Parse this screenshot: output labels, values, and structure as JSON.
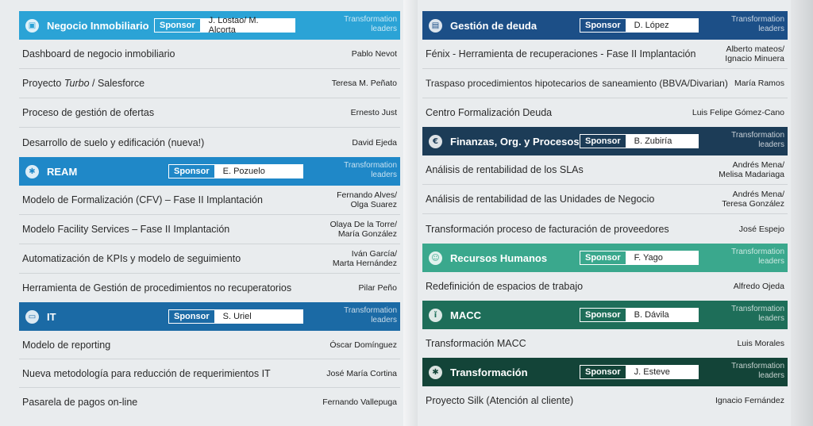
{
  "sponsor_label": "Sponsor",
  "tl_line1": "Transformation",
  "tl_line2": "leaders",
  "sections": {
    "negocio": {
      "title": "Negocio Inmobiliario",
      "sponsor": "J. Lostao/ M. Alcorta",
      "icon": "building-icon",
      "color": "#2ba3d6",
      "rows": [
        {
          "title": "Dashboard de negocio inmobiliario",
          "leader": "Pablo Nevot"
        },
        {
          "title_pre": "Proyecto ",
          "title_em": "Turbo",
          "title_post": " / Salesforce",
          "leader": "Teresa M. Peñato"
        },
        {
          "title": "Proceso de gestión de ofertas",
          "leader": "Ernesto Just"
        },
        {
          "title": "Desarrollo de suelo y edificación (nueva!)",
          "leader": "David Ejeda"
        }
      ]
    },
    "ream": {
      "title": "REAM",
      "sponsor": "E. Pozuelo",
      "icon": "gear-icon",
      "color": "#1f88c8",
      "rows": [
        {
          "title": "Modelo de Formalización (CFV) – Fase II Implantación",
          "leader1": "Fernando Alves/",
          "leader2": "Olga Suarez"
        },
        {
          "title": "Modelo Facility Services – Fase II Implantación",
          "leader1": "Olaya De la Torre/",
          "leader2": "María González"
        },
        {
          "title": "Automatización de KPIs y modelo de seguimiento",
          "leader1": "Iván García/",
          "leader2": "Marta Hernández"
        },
        {
          "title": "Herramienta de Gestión de procedimientos no recuperatorios",
          "leader": "Pilar Peño"
        }
      ]
    },
    "it": {
      "title": "IT",
      "sponsor": "S. Uriel",
      "icon": "monitor-icon",
      "color": "#1b6aa5",
      "rows": [
        {
          "title": "Modelo de reporting",
          "leader": "Óscar Domínguez"
        },
        {
          "title": "Nueva metodología para reducción de requerimientos IT",
          "leader": "José María Cortina"
        },
        {
          "title": "Pasarela de pagos on-line",
          "leader": "Fernando Vallepuga"
        }
      ]
    },
    "deuda": {
      "title": "Gestión de deuda",
      "sponsor": "D. López",
      "icon": "wallet-icon",
      "color": "#1c4f87",
      "rows": [
        {
          "title": "Fénix - Herramienta de recuperaciones - Fase II Implantación",
          "leader1": "Alberto mateos/",
          "leader2": "Ignacio Minuera"
        },
        {
          "title": "Traspaso procedimientos hipotecarios de saneamiento (BBVA/Divarian)",
          "leader": "María Ramos"
        },
        {
          "title": "Centro Formalización Deuda",
          "leader": "Luis Felipe Gómez-Cano"
        }
      ]
    },
    "finanzas": {
      "title": "Finanzas, Org. y Procesos",
      "sponsor": "B. Zubiría",
      "icon": "finance-icon",
      "color": "#1c3c57",
      "rows": [
        {
          "title": "Análisis de rentabilidad de los SLAs",
          "leader1": "Andrés Mena/",
          "leader2": "Melisa Madariaga"
        },
        {
          "title": "Análisis de rentabilidad de las Unidades de Negocio",
          "leader1": "Andrés Mena/",
          "leader2": "Teresa González"
        },
        {
          "title": "Transformación proceso de facturación de proveedores",
          "leader": "José Espejo"
        }
      ]
    },
    "rrhh": {
      "title": "Recursos Humanos",
      "sponsor": "F. Yago",
      "icon": "people-icon",
      "color": "#3aa88d",
      "rows": [
        {
          "title": "Redefinición de espacios de trabajo",
          "leader": "Alfredo Ojeda"
        }
      ]
    },
    "macc": {
      "title": "MACC",
      "sponsor": "B. Dávila",
      "icon": "person-icon",
      "color": "#1e6e59",
      "rows": [
        {
          "title": "Transformación MACC",
          "leader": "Luis Morales"
        }
      ]
    },
    "transformacion": {
      "title": "Transformación",
      "sponsor": "J. Esteve",
      "icon": "gear-icon",
      "color": "#134438",
      "rows": [
        {
          "title": "Proyecto Silk (Atención al cliente)",
          "leader": "Ignacio Fernández"
        }
      ]
    }
  }
}
